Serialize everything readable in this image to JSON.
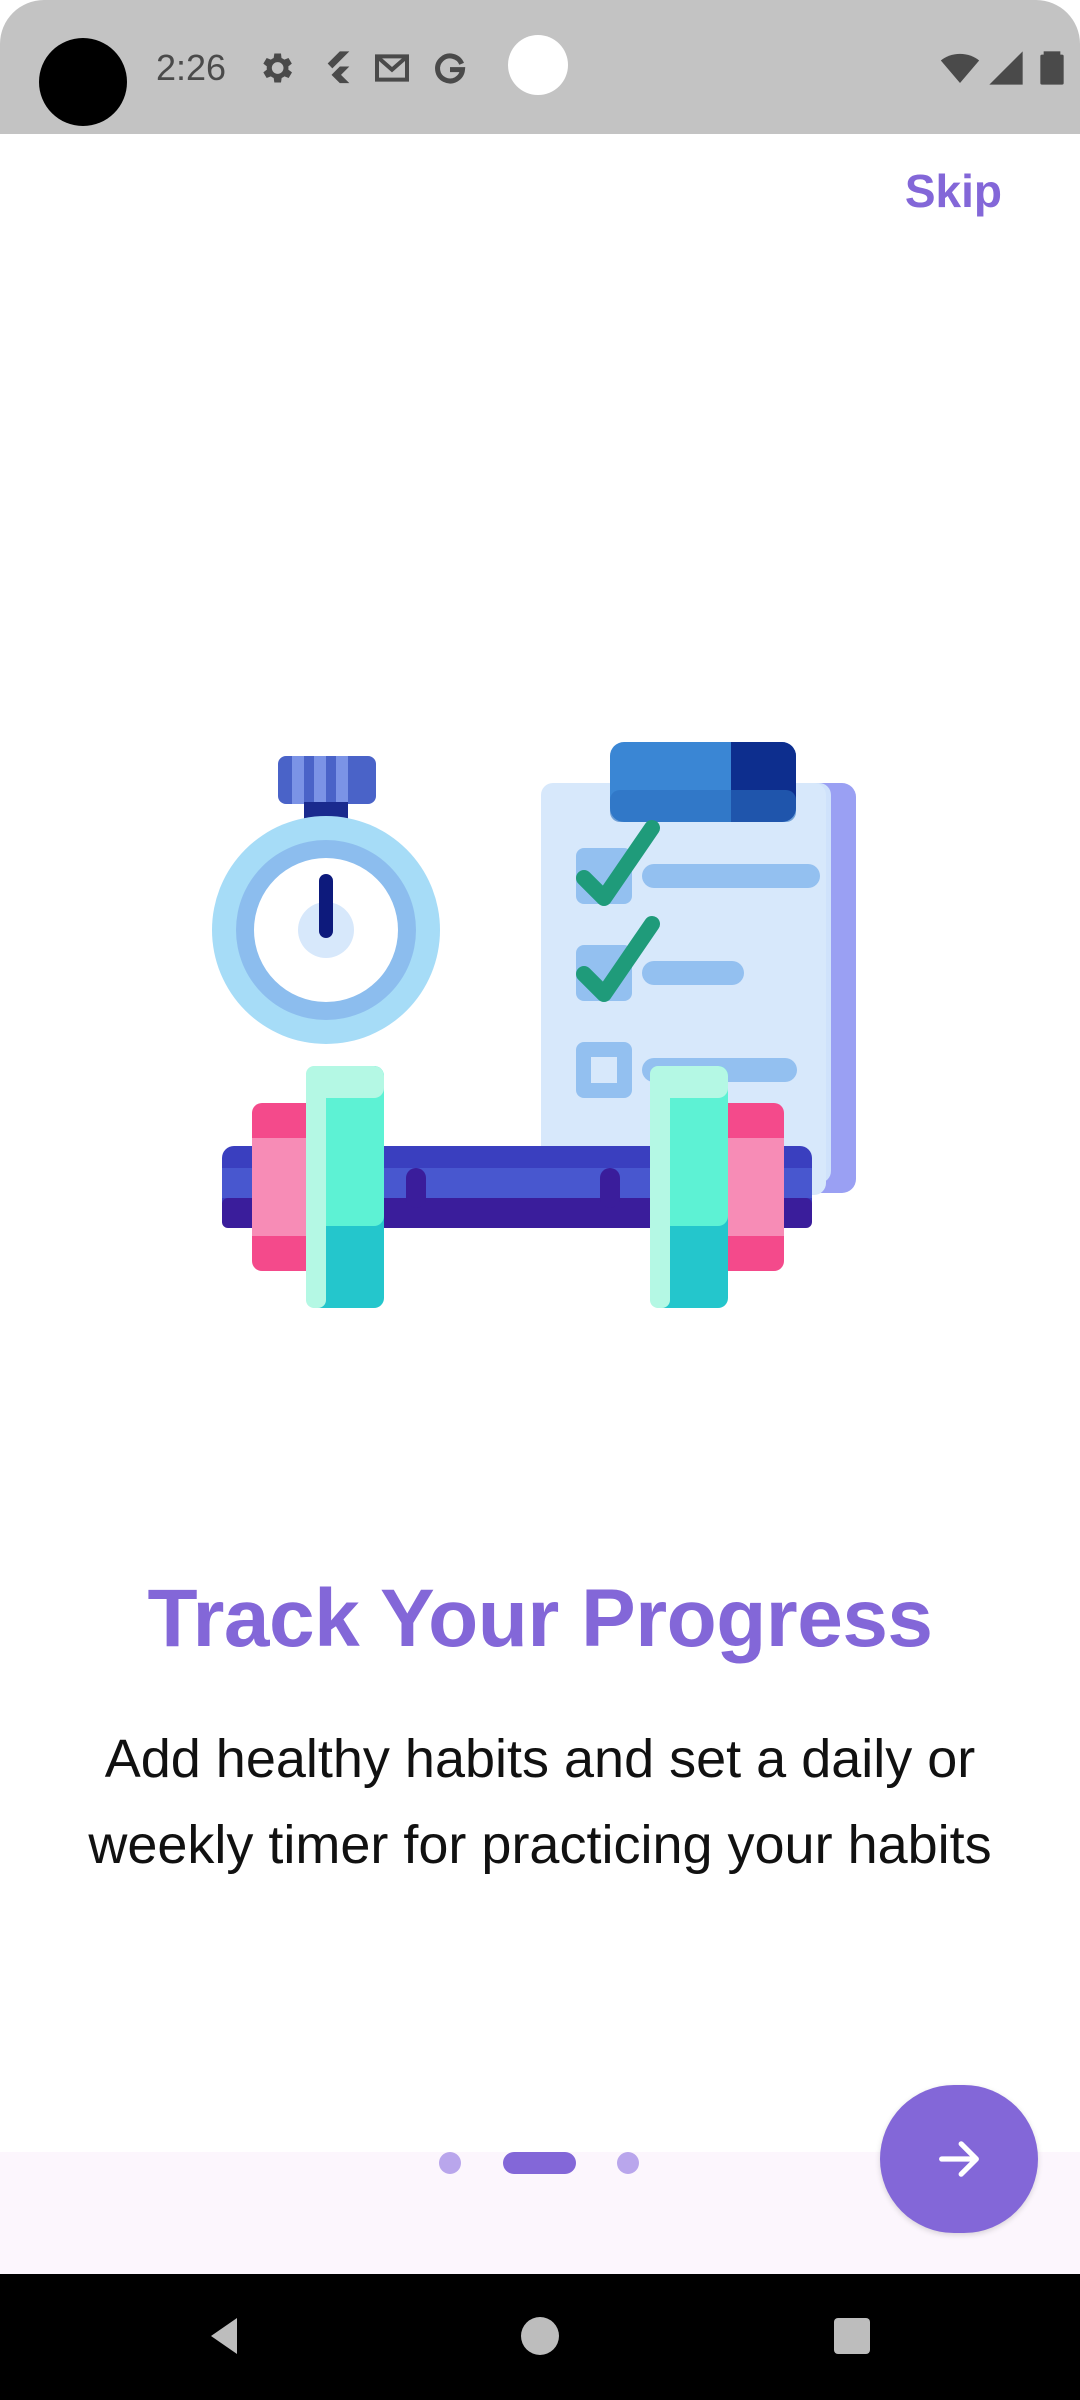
{
  "status_bar": {
    "time": "2:26",
    "icons": [
      "settings-icon",
      "flutter-icon",
      "gmail-icon",
      "google-icon",
      "wifi-icon",
      "signal-icon",
      "battery-icon"
    ]
  },
  "onboarding": {
    "skip_label": "Skip",
    "title": "Track Your Progress",
    "description_line1": "Add healthy habits and set a daily or",
    "description_line2": "weekly timer for practicing your habits",
    "page_indicator": {
      "current": 2,
      "total": 3
    }
  },
  "colors": {
    "accent": "#8367d8",
    "accent_light": "#b9a6ec",
    "status_bar": "#c3c3c3",
    "bottom_bar": "#fcf6fd"
  },
  "navigation": {
    "icons": [
      "back-icon",
      "home-icon",
      "recents-icon"
    ]
  }
}
